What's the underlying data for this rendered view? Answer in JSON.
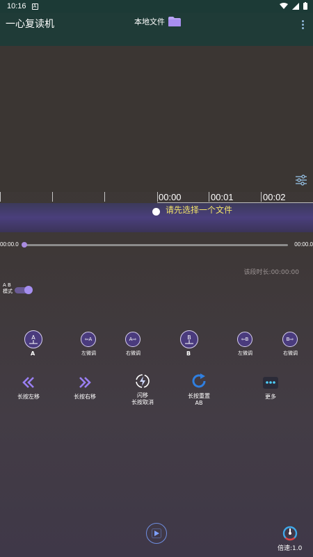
{
  "status_bar": {
    "time": "10:16",
    "badge": "A"
  },
  "header": {
    "app_title": "一心复读机",
    "local_files_label": "本地文件"
  },
  "timeline": {
    "labels": [
      "00:00",
      "00:01",
      "00:02"
    ]
  },
  "hint": {
    "text": "请先选择一个文件"
  },
  "progress": {
    "current": "00:00.0",
    "total": "00:00.0",
    "fraction": 0.0
  },
  "segment": {
    "duration_label": "该段时长:00:00:00"
  },
  "ab_mode": {
    "line1": "A  B",
    "line2": "模式",
    "enabled": true
  },
  "ab_controls": {
    "a_label": "A",
    "a_left_label": "左微调",
    "a_right_label": "右微调",
    "b_label": "B",
    "b_left_label": "左微调",
    "b_right_label": "右微调",
    "a_icon_text": "A",
    "a_left_icon_text": "⇦A",
    "a_right_icon_text": "A⇨",
    "b_icon_text": "B",
    "b_left_icon_text": "⇦B",
    "b_right_icon_text": "B⇨"
  },
  "actions": {
    "move_left": "长按左移",
    "move_right": "长按右移",
    "flash_line1": "闪移",
    "flash_line2": "长按取消",
    "reset_line1": "长按重置",
    "reset_line2": "AB",
    "more": "更多"
  },
  "footer": {
    "speed": "倍速:1.0"
  },
  "colors": {
    "accent": "#a58ef0",
    "hint": "#f2e36a",
    "header": "#1f3b37",
    "reset_blue": "#2f7fe0"
  }
}
